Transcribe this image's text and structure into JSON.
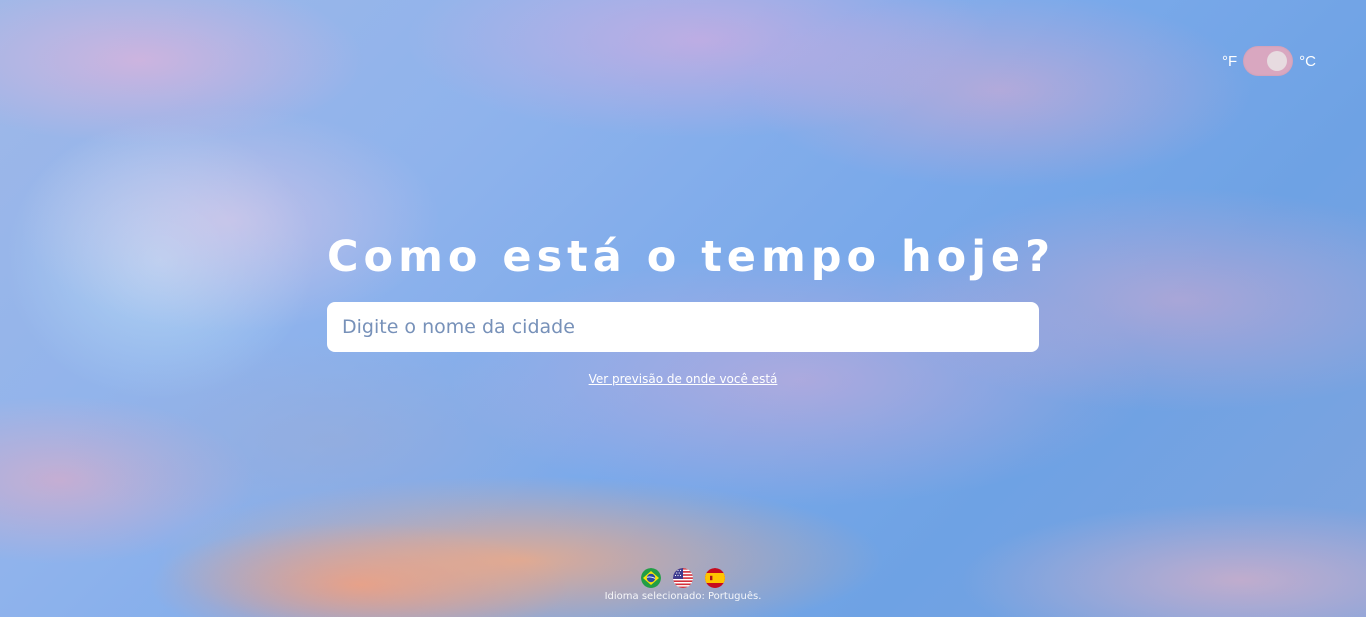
{
  "unit_toggle": {
    "left_label": "°F",
    "right_label": "°C",
    "selected": "°C",
    "track_color": "#d9a7c0"
  },
  "hero": {
    "title": "Como está o tempo hoje?",
    "search_placeholder": "Digite o nome da cidade",
    "geolocation_link": "Ver previsão de onde você está"
  },
  "language": {
    "flags": [
      {
        "icon": "brazil-flag-icon"
      },
      {
        "icon": "usa-flag-icon"
      },
      {
        "icon": "spain-flag-icon"
      }
    ],
    "selected_text": "Idioma selecionado: Português."
  }
}
